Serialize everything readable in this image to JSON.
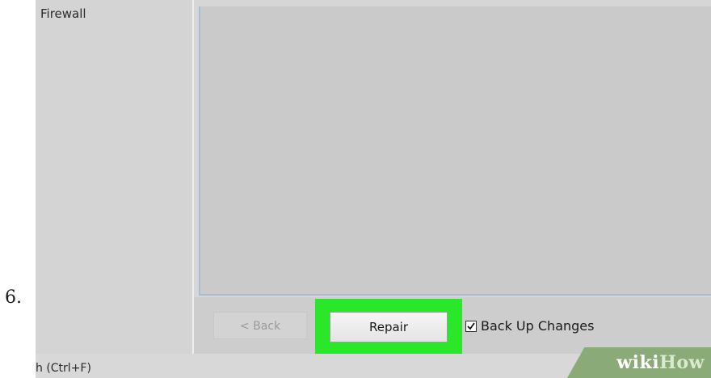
{
  "step": {
    "number": "6."
  },
  "sidebar": {
    "items": [
      {
        "label": "Firewall"
      }
    ]
  },
  "buttons": {
    "back_label": "< Back",
    "repair_label": "Repair"
  },
  "options": {
    "backup_changes": {
      "label": "Back Up Changes",
      "checked": true
    }
  },
  "status_bar": {
    "text": "h (Ctrl+F)"
  },
  "watermark": {
    "part1": "wiki",
    "part2": "How"
  },
  "colors": {
    "highlight": "#2be72b",
    "panel_background": "#cacaca",
    "panel_border": "#a9bcd4",
    "watermark_background": "#8aaa78"
  }
}
